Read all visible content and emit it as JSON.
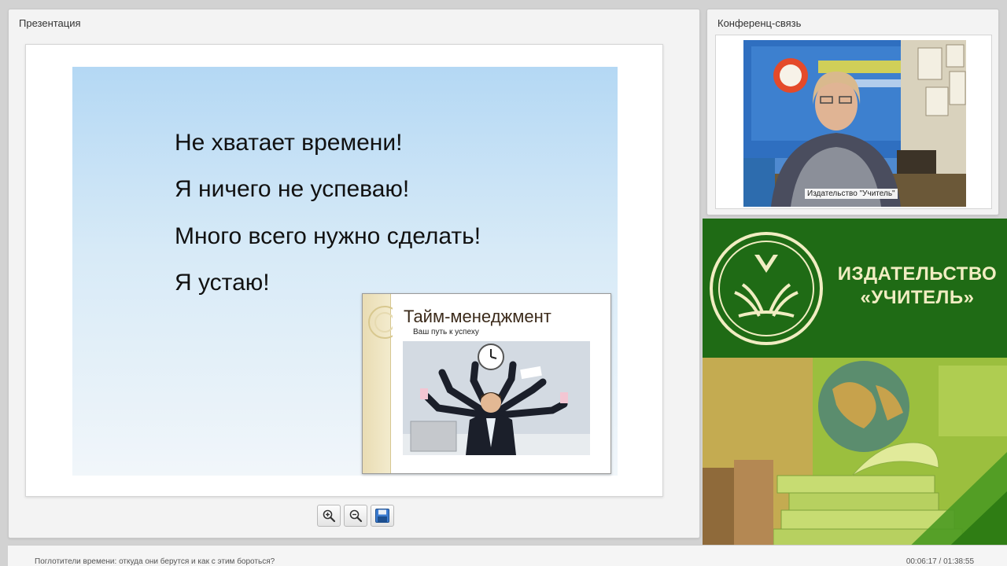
{
  "presentation": {
    "title": "Презентация",
    "slide": {
      "lines": [
        "Не хватает времени!",
        "Я ничего не успеваю!",
        "Много всего нужно сделать!",
        "Я устаю!"
      ],
      "inset": {
        "title": "Тайм-менеджмент",
        "subtitle": "Ваш путь к успеху"
      }
    },
    "toolbar": {
      "zoom_in_icon": "zoom-in-icon",
      "zoom_out_icon": "zoom-out-icon",
      "save_icon": "save-icon"
    }
  },
  "conference": {
    "title": "Конференц-связь",
    "video_label": "Издательство \"Учитель\""
  },
  "banner": {
    "line1": "ИЗДАТЕЛЬСТВО",
    "line2": "«УЧИТЕЛЬ»",
    "colors": {
      "green": "#1f6b15",
      "text": "#f1edc2"
    }
  },
  "footer": {
    "webinar_title": "Поглотители времени: откуда они берутся и как с этим бороться?",
    "time": "00:06:17 / 01:38:55"
  }
}
